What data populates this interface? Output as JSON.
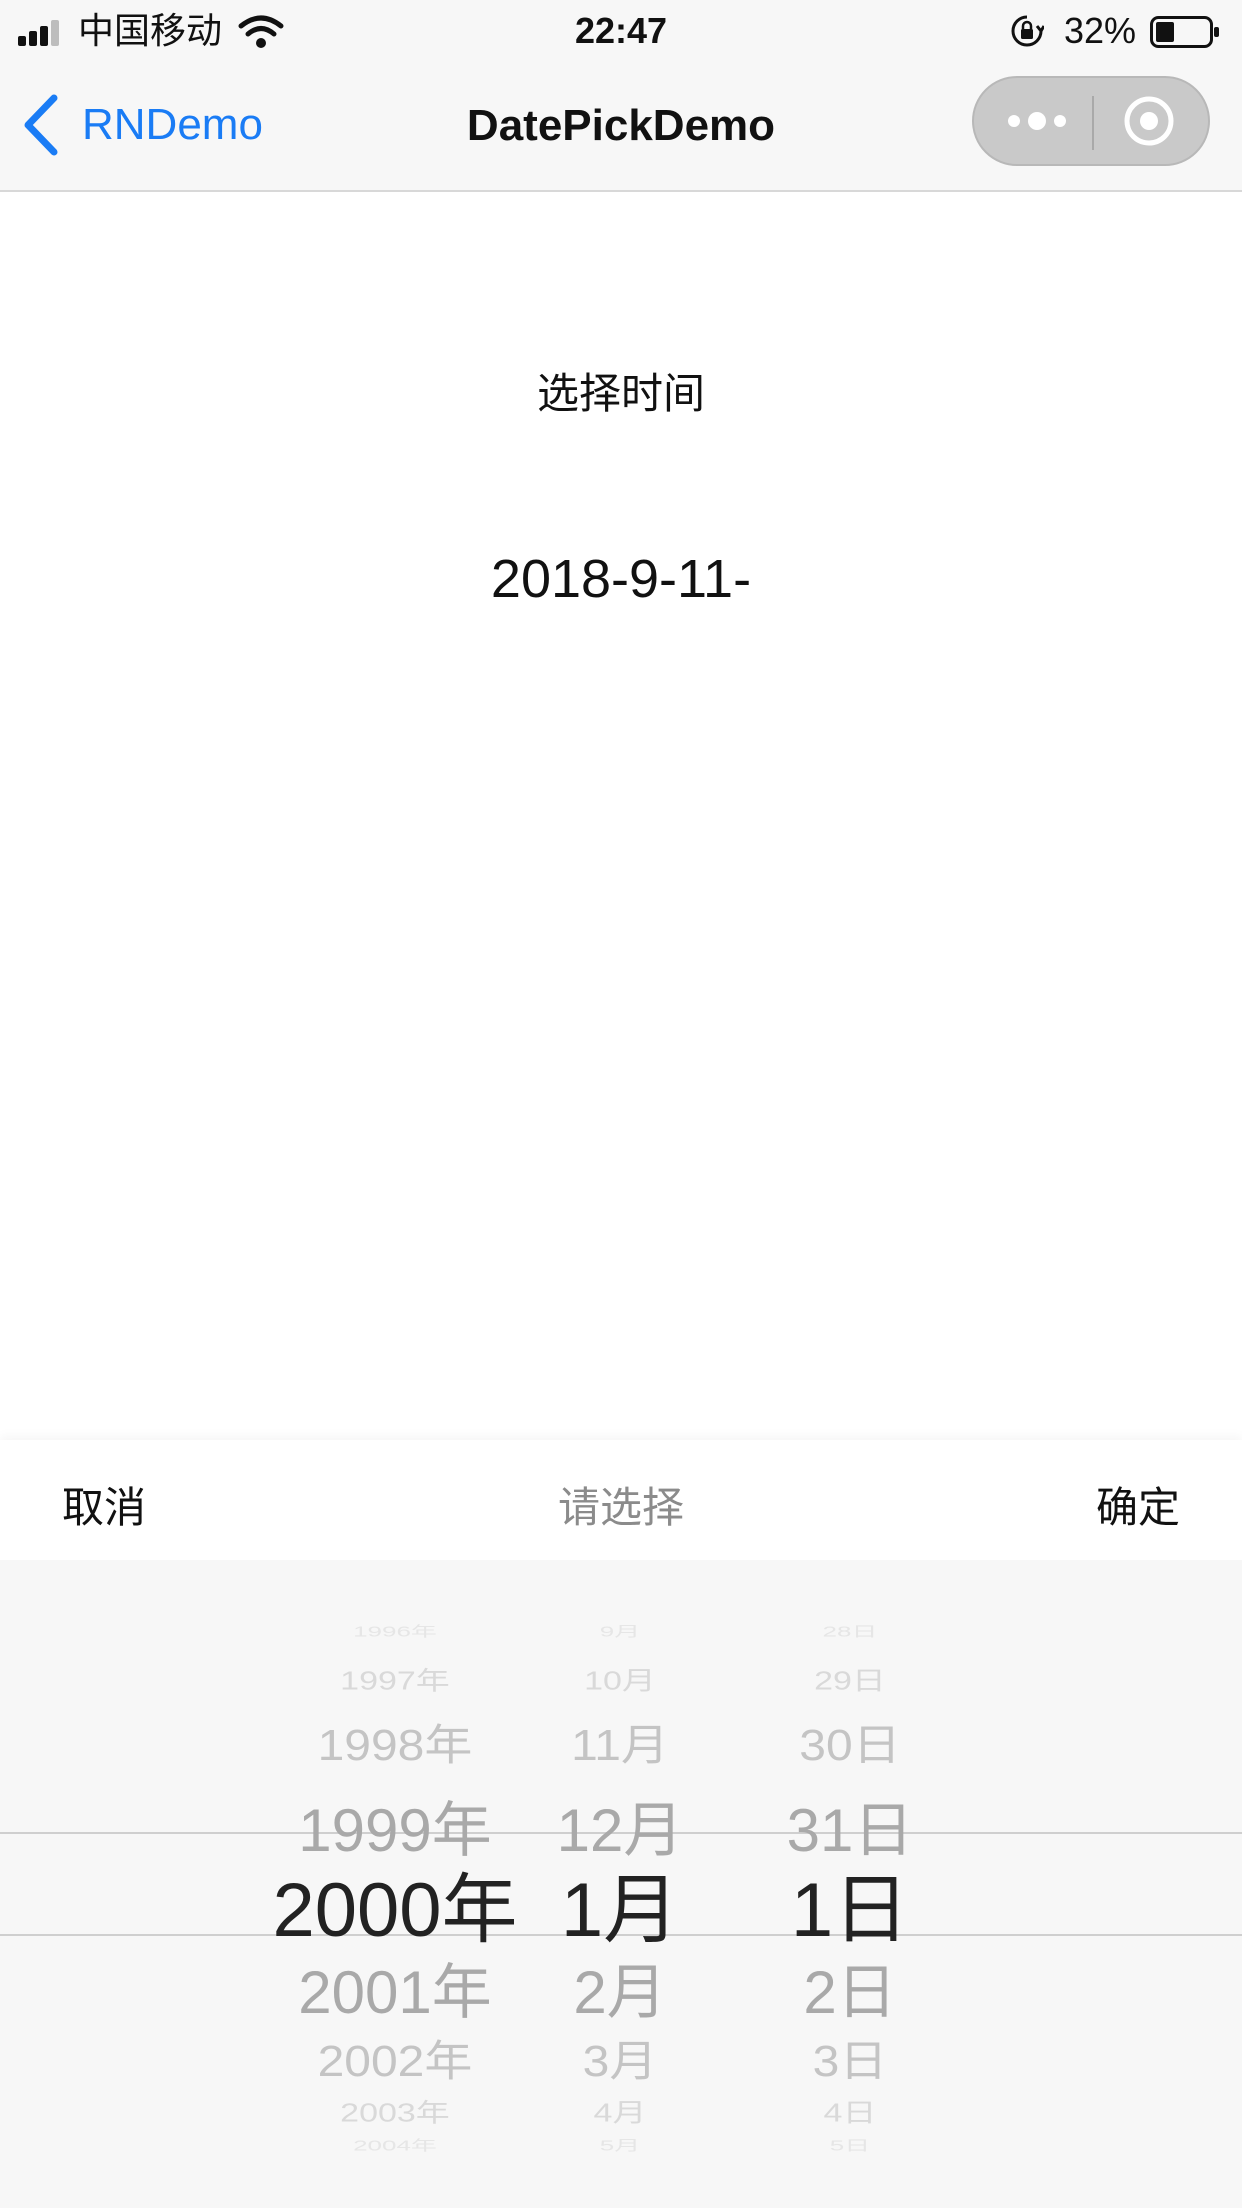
{
  "status_bar": {
    "carrier": "中国移动",
    "time": "22:47",
    "battery": "32%"
  },
  "nav": {
    "back_label": "RNDemo",
    "title": "DatePickDemo",
    "accent_color": "#1a7cf5"
  },
  "content": {
    "select_label": "选择时间",
    "date_value": "2018-9-11-"
  },
  "picker": {
    "cancel": "取消",
    "title": "请选择",
    "confirm": "确定",
    "years": [
      "1996年",
      "1997年",
      "1998年",
      "1999年",
      "2000年",
      "2001年",
      "2002年",
      "2003年",
      "2004年"
    ],
    "months": [
      "9月",
      "10月",
      "11月",
      "12月",
      "1月",
      "2月",
      "3月",
      "4月",
      "5月"
    ],
    "days": [
      "28日",
      "29日",
      "30日",
      "31日",
      "1日",
      "2日",
      "3日",
      "4日",
      "5日"
    ],
    "selected": {
      "year": "2000年",
      "month": "1月",
      "day": "1日"
    }
  }
}
